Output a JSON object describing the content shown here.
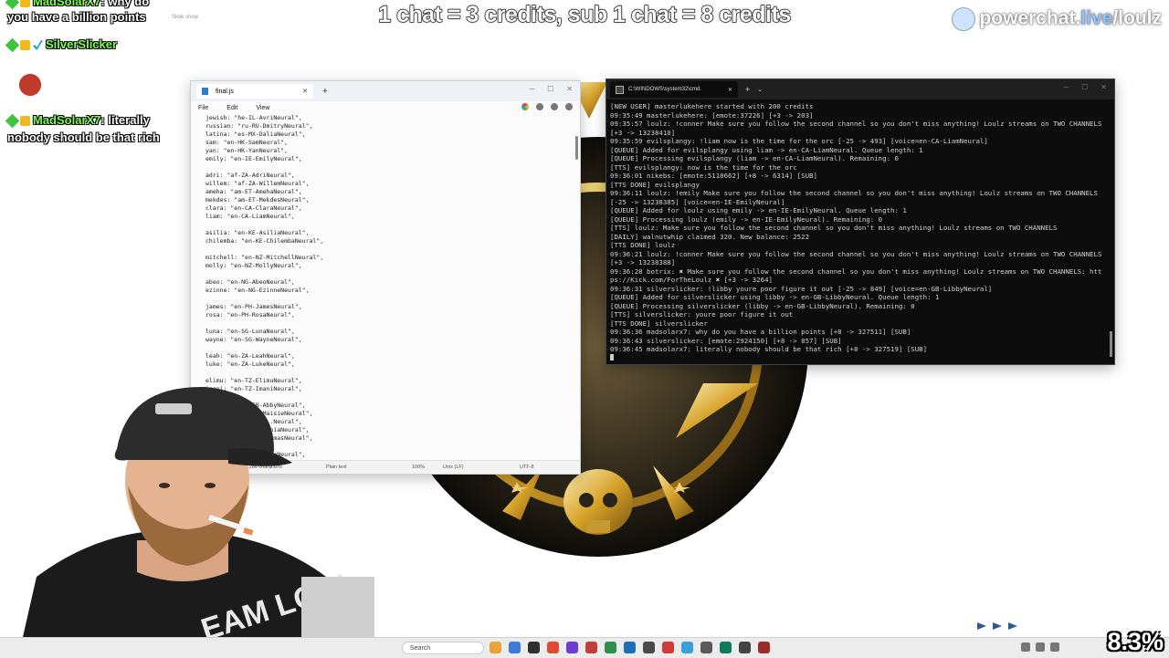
{
  "overlay": {
    "banner": "1 chat = 3 credits, sub 1 chat = 8 credits",
    "brand_main": "powerchat.",
    "brand_live": "live",
    "brand_tail": "/loulz",
    "zoom": "8.3%",
    "tiny_label": "Slide show"
  },
  "chat": [
    {
      "user": "MadSolarX7",
      "text": "why do"
    },
    {
      "text": "you have a billion points"
    },
    {
      "user": "SilverSlicker",
      "text": ""
    },
    {
      "user": "MadSolarX7",
      "text": "literally"
    },
    {
      "text": "nobody should be that rich"
    }
  ],
  "notepad": {
    "tab_title": "final.js",
    "menu": [
      "File",
      "Edit",
      "View"
    ],
    "lines": [
      "jewish: \"he-IL-AvriNeural\",",
      "russian: \"ru-RU-DmitryNeural\",",
      "latina: \"es-MX-DaliaNeural\",",
      "sam: \"en-HK-SamNeural\",",
      "yan: \"en-HK-YanNeural\",",
      "emily: \"en-IE-EmilyNeural\",",
      "",
      "adri: \"af-ZA-AdriNeural\",",
      "willem: \"af-ZA-WillemNeural\",",
      "ameha: \"am-ET-AmehaNeural\",",
      "mekdes: \"am-ET-MekdesNeural\",",
      "clara: \"en-CA-ClaraNeural\",",
      "liam: \"en-CA-LiamNeural\",",
      "",
      "asilia: \"en-KE-AsiliaNeural\",",
      "chilemba: \"en-KE-ChilembaNeural\",",
      "",
      "mitchell: \"en-NZ-MitchellNeural\",",
      "molly: \"en-NZ-MollyNeural\",",
      "",
      "abeo: \"en-NG-AbeoNeural\",",
      "ezinne: \"en-NG-EzinneNeural\",",
      "",
      "james: \"en-PH-JamesNeural\",",
      "rosa: \"en-PH-RosaNeural\",",
      "",
      "luna: \"en-SG-LunaNeural\",",
      "wayne: \"en-SG-WayneNeural\",",
      "",
      "leah: \"en-ZA-LeahNeural\",",
      "luke: \"en-ZA-LukeNeural\",",
      "",
      "elimu: \"en-TZ-ElimuNeural\",",
      "imani: \"en-TZ-ImaniNeural\",",
      "",
      "         \"en-GB-AbbyNeural\",",
      "         \"en-GB-MaisieNeural\",",
      "         \"en-GB-...Neural\",",
      "         \"en-GB-SoniaNeural\",",
      "         \"en-GB-ThomasNeural\",",
      "",
      "         \"en-US-AriaNeural\","
    ],
    "status": {
      "chars": "44,286 characters",
      "type": "Plain text",
      "zoom": "100%",
      "eol": "Unix (LF)",
      "encoding": "UTF-8"
    }
  },
  "cmd": {
    "tab_title": "C:\\WINDOWS\\system32\\cmd.",
    "lines": [
      "[NEW USER] masterlukehere started with 200 credits",
      "09:35:49 masterlukehere: [emote:37226] [+3 -> 203]",
      "09:35:57 loulz: !conner Make sure you follow the second channel so you don't miss anything! Loulz streams on TWO CHANNELS [+3 -> 13238410]",
      "09:35:59 evilsplangy: !liam now is the time for the orc [-25 -> 493] [voice=en-CA-LiamNeural]",
      "[QUEUE] Added for evilsplangy using liam -> en-CA-LiamNeural. Queue length: 1",
      "[QUEUE] Processing evilsplangy (liam -> en-CA-LiamNeural). Remaining: 0",
      "[TTS] evilsplangy: now is the time for the orc",
      "09:36:01 nikebs: [emote:5110662] [+8 -> 6314] [SUB]",
      "[TTS DONE] evilsplangy",
      "09:36:11 loulz: !emily Make sure you follow the second channel so you don't miss anything! Loulz streams on TWO CHANNELS [-25 -> 13238385] [voice=en-IE-EmilyNeural]",
      "[QUEUE] Added for loulz using emily -> en-IE-EmilyNeural. Queue length: 1",
      "[QUEUE] Processing loulz (emily -> en-IE-EmilyNeural). Remaining: 0",
      "[TTS] loulz: Make sure you follow the second channel so you don't miss anything! Loulz streams on TWO CHANNELS",
      "[DAILY] walnutwhip claimed 320. New balance: 2522",
      "[TTS DONE] loulz",
      "09:36:21 loulz: !conner Make sure you follow the second channel so you don't miss anything! Loulz streams on TWO CHANNELS [+3 -> 13238388]",
      "09:36:28 botrix: ✖ Make sure you follow the second channel so you don't miss anything! Loulz streams on TWO CHANNELS: https://Kick.com/ForTheLoulz ✖ [+3 -> 3264]",
      "09:36:31 silverslicker: !libby youre poor figure it out [-25 -> 849] [voice=en-GB-LibbyNeural]",
      "[QUEUE] Added for silverslicker using libby -> en-GB-LibbyNeural. Queue length: 1",
      "[QUEUE] Processing silverslicker (libby -> en-GB-LibbyNeural). Remaining: 0",
      "[TTS] silverslicker: youre poor figure it out",
      "[TTS DONE] silverslicker",
      "09:36:36 madsolarx7: why do you have a billion points [+8 -> 327511] [SUB]",
      "09:36:43 silverslicker: [emote:2924150] [+8 -> 857] [SUB]",
      "09:36:45 madsolarx7: literally nobody should be that rich [+8 -> 327519] [SUB]"
    ]
  },
  "taskbar": {
    "search": "Search",
    "app_colors": [
      "#e8a33d",
      "#3a7bd5",
      "#2f2f2f",
      "#e04a2f",
      "#6c3fd1",
      "#c43d3d",
      "#2f8f4e",
      "#1d6fb8",
      "#4a4a4a",
      "#d23a3a",
      "#3aa0d8",
      "#5a5a5a",
      "#0f7a5a",
      "#444444",
      "#9b2c2c"
    ]
  }
}
